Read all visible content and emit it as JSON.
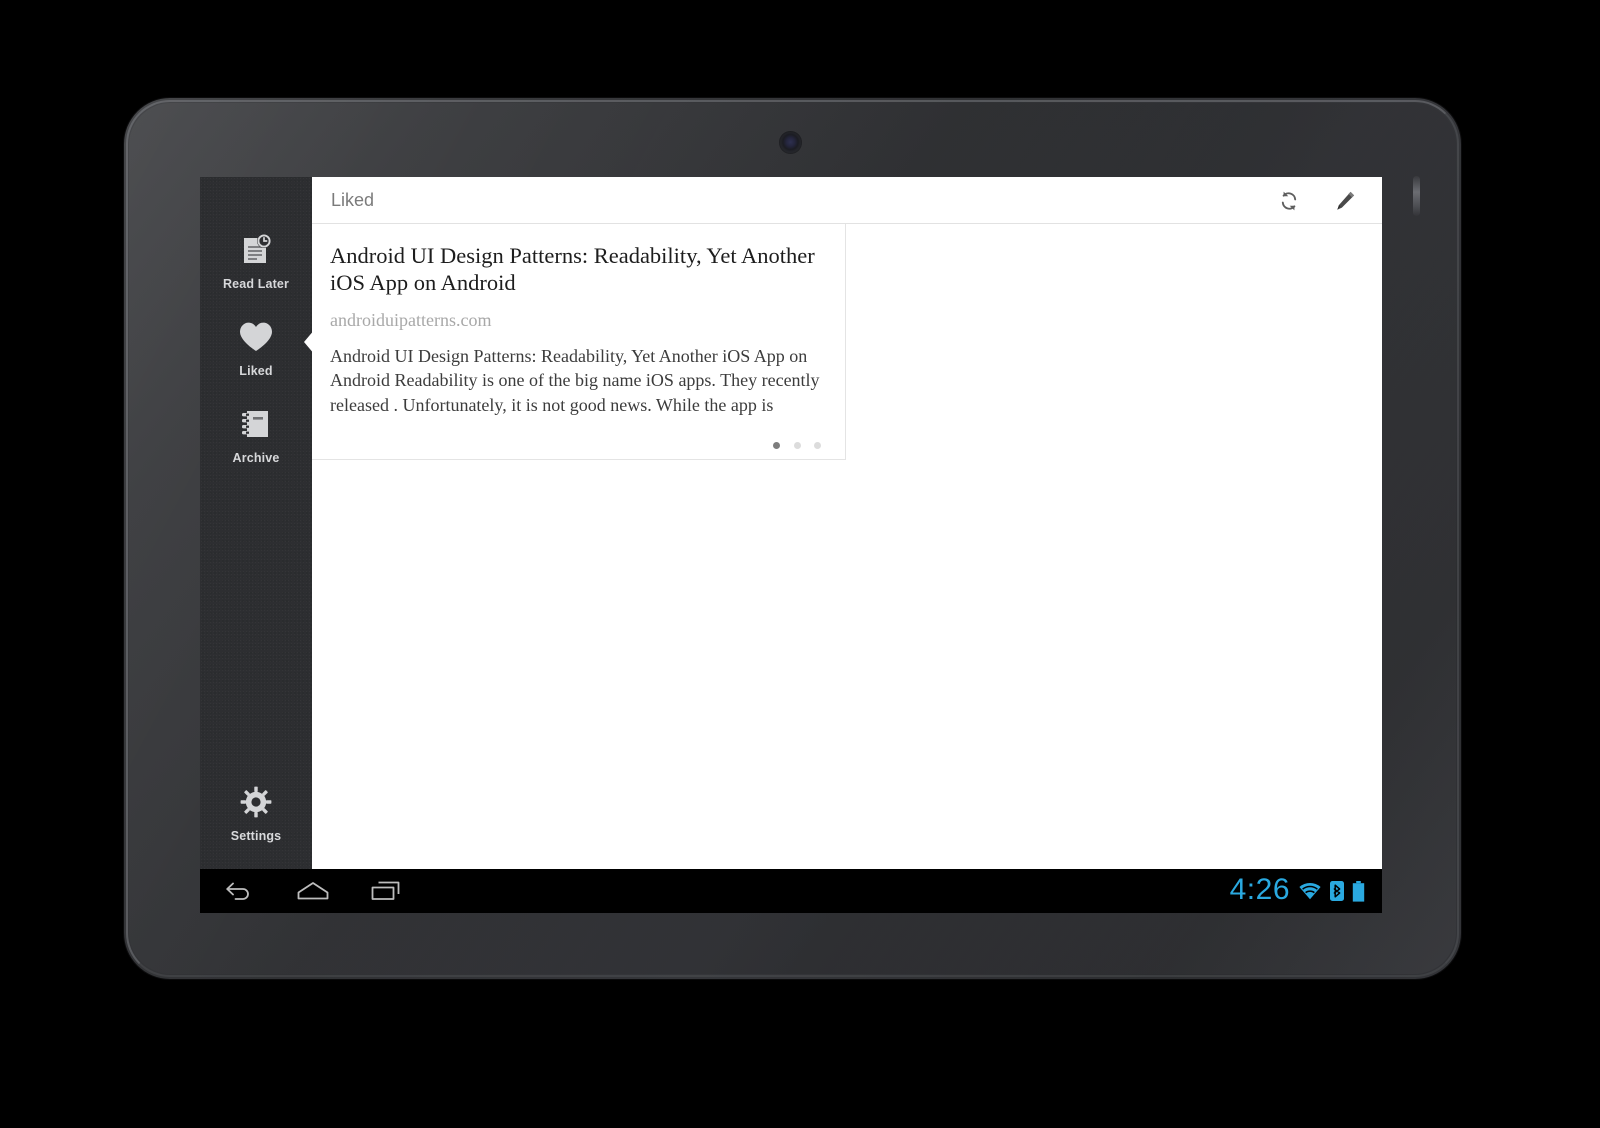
{
  "device": {
    "camera_icon": "front-camera-icon",
    "power_button": "power-button"
  },
  "sidebar": {
    "items": [
      {
        "id": "read-later",
        "label": "Read Later",
        "icon": "document-clock-icon",
        "active": false
      },
      {
        "id": "liked",
        "label": "Liked",
        "icon": "heart-icon",
        "active": true
      },
      {
        "id": "archive",
        "label": "Archive",
        "icon": "notebook-icon",
        "active": false
      },
      {
        "id": "settings",
        "label": "Settings",
        "icon": "gear-icon",
        "active": false
      }
    ],
    "background_color": "#2d2e31",
    "label_color": "#d7d8da"
  },
  "header": {
    "title": "Liked",
    "actions": [
      {
        "id": "refresh",
        "icon": "refresh-sync-icon"
      },
      {
        "id": "compose",
        "icon": "pencil-edit-icon"
      }
    ]
  },
  "article": {
    "title": "Android UI Design Patterns: Readability, Yet Another iOS App on Android",
    "source": "androiduipatterns.com",
    "excerpt": "Android UI Design Patterns: Readability, Yet Another iOS App on Android Readability is one of the big name iOS apps. They recently released . Unfortunately, it is not good news. While the app is",
    "pagination": {
      "total": 3,
      "active_index": 0
    }
  },
  "system_bar": {
    "buttons": [
      {
        "id": "back",
        "icon": "back-arrow-icon"
      },
      {
        "id": "home",
        "icon": "home-icon"
      },
      {
        "id": "recent",
        "icon": "recent-apps-icon"
      }
    ],
    "clock": "4:26",
    "clock_color": "#2aa9e0",
    "indicators": [
      {
        "id": "wifi",
        "icon": "wifi-icon"
      },
      {
        "id": "bluetooth",
        "icon": "bluetooth-icon"
      },
      {
        "id": "battery",
        "icon": "battery-icon"
      }
    ]
  }
}
